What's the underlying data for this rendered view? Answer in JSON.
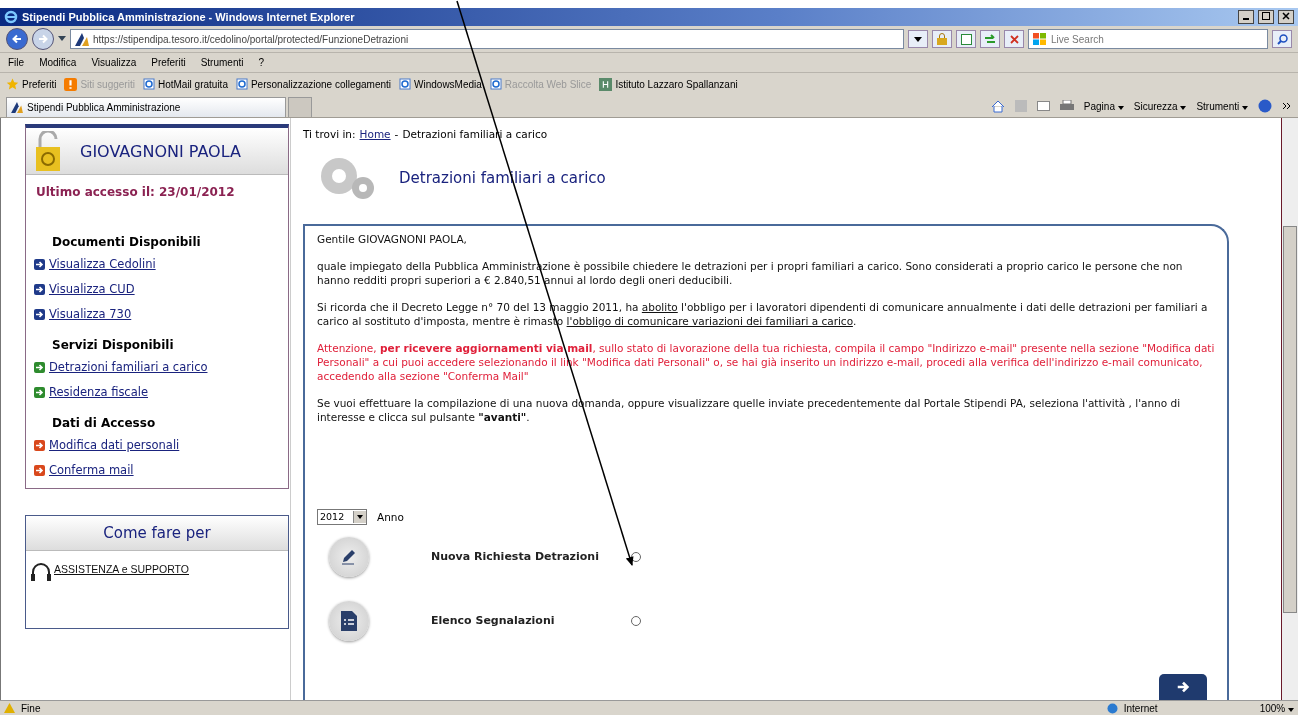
{
  "window": {
    "title": "Stipendi Pubblica Amministrazione - Windows Internet Explorer"
  },
  "address_bar": {
    "url": "https://stipendipa.tesoro.it/cedolino/portal/protected/FunzioneDetrazioni"
  },
  "search": {
    "placeholder": "Live Search"
  },
  "menu": [
    "File",
    "Modifica",
    "Visualizza",
    "Preferiti",
    "Strumenti",
    "?"
  ],
  "favorites_bar": [
    {
      "label": "Preferiti",
      "kind": "star",
      "disabled": false
    },
    {
      "label": "Siti suggeriti",
      "kind": "suggest",
      "disabled": true
    },
    {
      "label": "HotMail gratuita",
      "kind": "page",
      "disabled": false
    },
    {
      "label": "Personalizzazione collegamenti",
      "kind": "page",
      "disabled": false
    },
    {
      "label": "WindowsMedia",
      "kind": "page",
      "disabled": false
    },
    {
      "label": "Raccolta Web Slice",
      "kind": "page",
      "disabled": true
    },
    {
      "label": "Istituto Lazzaro Spallanzani",
      "kind": "site",
      "disabled": false
    }
  ],
  "tabs": [
    {
      "label": "Stipendi Pubblica Amministrazione",
      "selected": true
    }
  ],
  "command_bar": [
    "Pagina",
    "Sicurezza",
    "Strumenti"
  ],
  "sidebar": {
    "user": "GIOVAGNONI PAOLA",
    "last_access": "Ultimo accesso il: 23/01/2012",
    "sections": [
      {
        "title": "Documenti Disponibili",
        "color": "#1f3a8a",
        "links": [
          "Visualizza Cedolini",
          "Visualizza CUD",
          "Visualizza 730"
        ]
      },
      {
        "title": "Servizi Disponibili",
        "color": "#2e8b2e",
        "links": [
          "Detrazioni familiari a carico",
          "Residenza fiscale"
        ]
      },
      {
        "title": "Dati di Accesso",
        "color": "#d9481c",
        "links": [
          "Modifica dati personali",
          "Conferma mail"
        ]
      }
    ]
  },
  "help_box": {
    "title": "Come fare per",
    "link": "ASSISTENZA e SUPPORTO"
  },
  "breadcrumb": {
    "label": "Ti trovi in:",
    "separator": "-",
    "items": [
      "Home",
      "Detrazioni familiari a carico"
    ]
  },
  "page_title": "Detrazioni familiari a carico",
  "message": {
    "greeting": "Gentile GIOVAGNONI PAOLA,",
    "paragraphs": [
      {
        "kind": "normal",
        "segments": [
          {
            "kind": "plain",
            "text": "quale impiegato della Pubblica Amministrazione è possibile chiedere le detrazioni per i propri familiari a carico. Sono considerati a proprio carico le persone che non hanno redditi propri superiori a € 2.840,51 annui al lordo degli oneri deducibili."
          }
        ]
      },
      {
        "kind": "normal",
        "segments": [
          {
            "kind": "plain",
            "text": "Si ricorda che il Decreto Legge n° 70 del 13 maggio 2011, ha "
          },
          {
            "kind": "underline",
            "text": "abolito"
          },
          {
            "kind": "plain",
            "text": " l'obbligo per i lavoratori dipendenti di comunicare annualmente i dati delle detrazioni per familiari a carico al sostituto d'imposta, mentre è rimasto "
          },
          {
            "kind": "underline",
            "text": "l'obbligo di comunicare variazioni dei familiari a carico"
          },
          {
            "kind": "plain",
            "text": "."
          }
        ]
      },
      {
        "kind": "warning",
        "segments": [
          {
            "kind": "plain",
            "text": "Attenzione, "
          },
          {
            "kind": "bold",
            "text": "per ricevere aggiornamenti via mail"
          },
          {
            "kind": "plain",
            "text": ", sullo stato di lavorazione della tua richiesta, compila il campo \"Indirizzo e-mail\" presente nella sezione \"Modifica dati Personali\" a cui puoi accedere selezionando il link \"Modifica dati Personali\" o, se hai già inserito un indirizzo e-mail, procedi alla verifica dell'indirizzo e-mail comunicato, accedendo alla sezione \"Conferma Mail\""
          }
        ]
      },
      {
        "kind": "normal",
        "segments": [
          {
            "kind": "plain",
            "text": "Se vuoi effettuare la compilazione di una nuova domanda, oppure visualizzare quelle inviate precedentemente dal Portale Stipendi PA, seleziona l'attività , l'anno di interesse e clicca sul pulsante "
          },
          {
            "kind": "bold",
            "text": "\"avanti\""
          },
          {
            "kind": "plain",
            "text": "."
          }
        ]
      }
    ]
  },
  "year_select": {
    "value": "2012",
    "label": "Anno"
  },
  "options": [
    {
      "label": "Nuova Richiesta Detrazioni",
      "kind": "pencil",
      "selected": false
    },
    {
      "label": "Elenco Segnalazioni",
      "kind": "list",
      "selected": false
    }
  ],
  "status_bar": {
    "status": "Fine",
    "zone": "Internet",
    "zoom": "100%"
  }
}
